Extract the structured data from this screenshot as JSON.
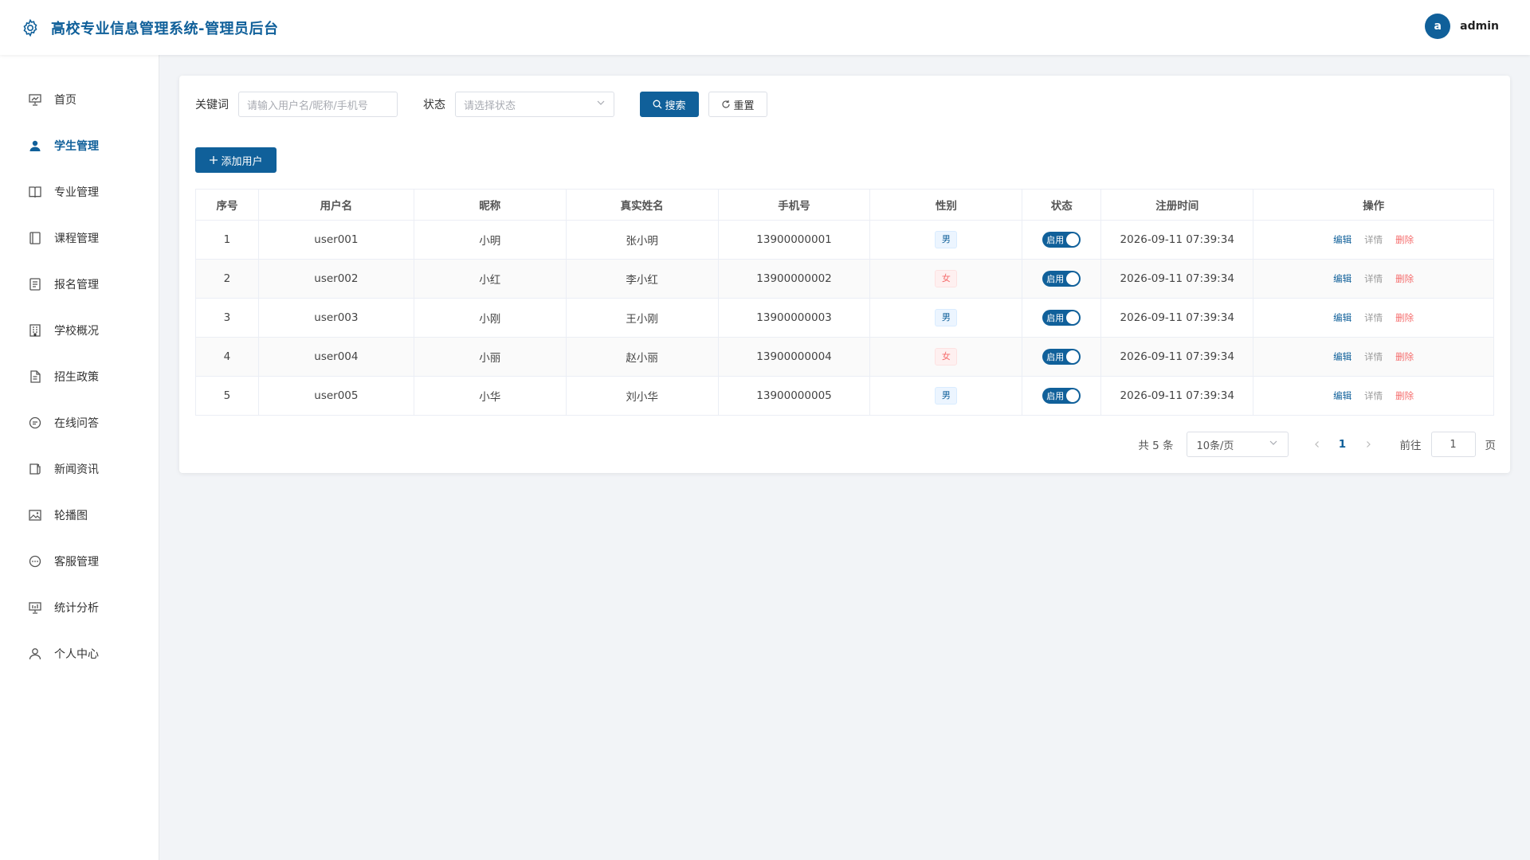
{
  "header": {
    "title": "高校专业信息管理系统-管理员后台",
    "avatar_letter": "a",
    "username": "admin"
  },
  "sidebar": {
    "items": [
      {
        "label": "首页",
        "icon": "presentation-icon"
      },
      {
        "label": "学生管理",
        "icon": "user-icon",
        "active": true
      },
      {
        "label": "专业管理",
        "icon": "book-icon"
      },
      {
        "label": "课程管理",
        "icon": "notebook-icon"
      },
      {
        "label": "报名管理",
        "icon": "document-icon"
      },
      {
        "label": "学校概况",
        "icon": "building-icon"
      },
      {
        "label": "招生政策",
        "icon": "file-text-icon"
      },
      {
        "label": "在线问答",
        "icon": "chat-icon"
      },
      {
        "label": "新闻资讯",
        "icon": "news-icon"
      },
      {
        "label": "轮播图",
        "icon": "image-icon"
      },
      {
        "label": "客服管理",
        "icon": "chat-dots-icon"
      },
      {
        "label": "统计分析",
        "icon": "chart-icon"
      },
      {
        "label": "个人中心",
        "icon": "user-outline-icon"
      }
    ]
  },
  "filters": {
    "keyword_label": "关键词",
    "keyword_placeholder": "请输入用户名/昵称/手机号",
    "status_label": "状态",
    "status_placeholder": "请选择状态",
    "search_label": "搜索",
    "reset_label": "重置"
  },
  "add_button": "添加用户",
  "table": {
    "headers": [
      "序号",
      "用户名",
      "昵称",
      "真实姓名",
      "手机号",
      "性别",
      "状态",
      "注册时间",
      "操作"
    ],
    "rows": [
      {
        "no": "1",
        "username": "user001",
        "nickname": "小明",
        "realname": "张小明",
        "phone": "13900000001",
        "gender": "男",
        "status": "启用",
        "time": "2026-09-11 07:39:34"
      },
      {
        "no": "2",
        "username": "user002",
        "nickname": "小红",
        "realname": "李小红",
        "phone": "13900000002",
        "gender": "女",
        "status": "启用",
        "time": "2026-09-11 07:39:34"
      },
      {
        "no": "3",
        "username": "user003",
        "nickname": "小刚",
        "realname": "王小刚",
        "phone": "13900000003",
        "gender": "男",
        "status": "启用",
        "time": "2026-09-11 07:39:34"
      },
      {
        "no": "4",
        "username": "user004",
        "nickname": "小丽",
        "realname": "赵小丽",
        "phone": "13900000004",
        "gender": "女",
        "status": "启用",
        "time": "2026-09-11 07:39:34"
      },
      {
        "no": "5",
        "username": "user005",
        "nickname": "小华",
        "realname": "刘小华",
        "phone": "13900000005",
        "gender": "男",
        "status": "启用",
        "time": "2026-09-11 07:39:34"
      }
    ],
    "ops": {
      "edit": "编辑",
      "detail": "详情",
      "delete": "删除"
    }
  },
  "pagination": {
    "total_text": "共 5 条",
    "page_size": "10条/页",
    "current": "1",
    "goto_label": "前往",
    "goto_value": "1",
    "page_suffix": "页"
  },
  "colors": {
    "primary": "#10609a",
    "danger": "#f56c6c"
  }
}
